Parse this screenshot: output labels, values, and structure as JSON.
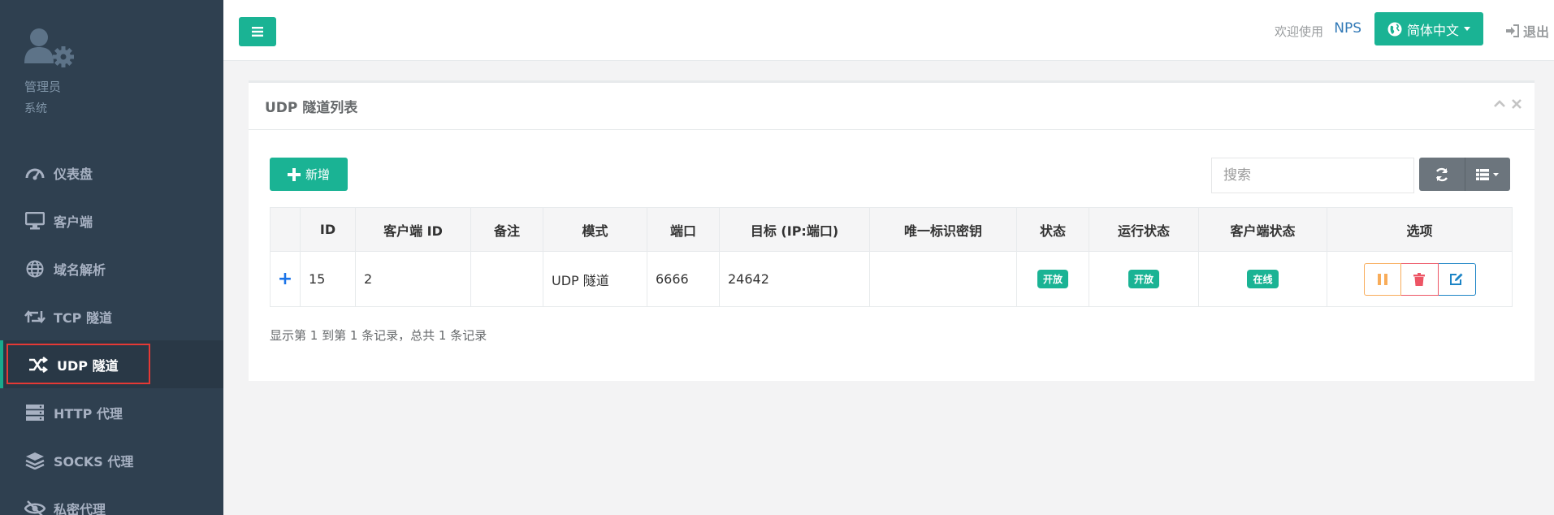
{
  "profile": {
    "name": "管理员",
    "role": "系统"
  },
  "nav": [
    {
      "label": "仪表盘",
      "icon": "dashboard-icon"
    },
    {
      "label": "客户端",
      "icon": "desktop-icon"
    },
    {
      "label": "域名解析",
      "icon": "globe-icon"
    },
    {
      "label": "TCP 隧道",
      "icon": "retweet-icon"
    },
    {
      "label": "UDP 隧道",
      "icon": "random-icon",
      "active": true
    },
    {
      "label": "HTTP 代理",
      "icon": "server-icon"
    },
    {
      "label": "SOCKS 代理",
      "icon": "layers-icon"
    },
    {
      "label": "私密代理",
      "icon": "eye-slash-icon"
    }
  ],
  "topbar": {
    "welcome": "欢迎使用",
    "brand": "NPS",
    "language": "简体中文",
    "logout": "退出"
  },
  "panel": {
    "title": "UDP 隧道列表",
    "add_label": "新增",
    "search_placeholder": "搜索",
    "columns": [
      "",
      "ID",
      "客户端 ID",
      "备注",
      "模式",
      "端口",
      "目标 (IP:端口)",
      "唯一标识密钥",
      "状态",
      "运行状态",
      "客户端状态",
      "选项"
    ],
    "rows": [
      {
        "expand": "+",
        "id": "15",
        "client_id": "2",
        "remark": "",
        "mode": "UDP 隧道",
        "port": "6666",
        "target": "24642",
        "key": "",
        "status": "开放",
        "run_status": "开放",
        "client_status": "在线"
      }
    ],
    "pager_info": "显示第 1 到第 1 条记录，总共 1 条记录"
  },
  "colors": {
    "sidebar": "#2f4050",
    "accent": "#1ab394",
    "active_border": "#e53935"
  }
}
